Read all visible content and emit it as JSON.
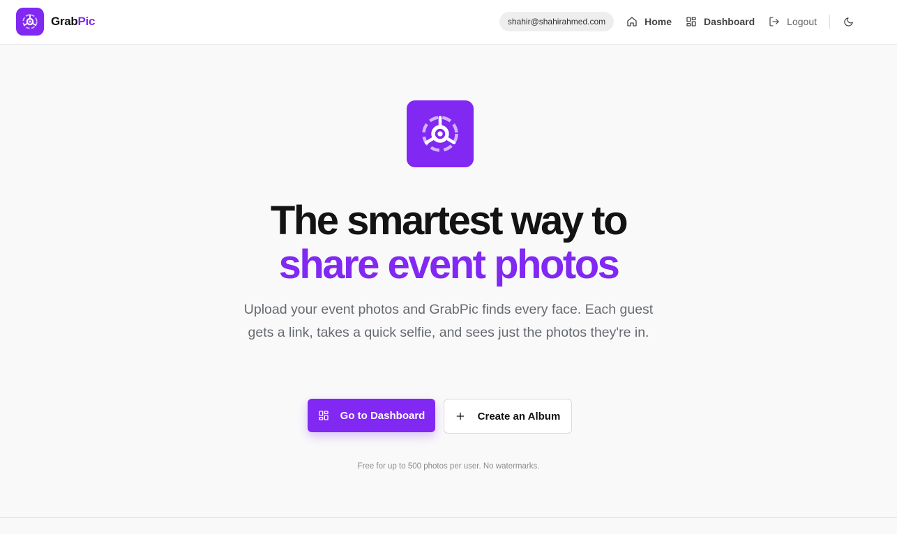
{
  "header": {
    "brand_part1": "Grab",
    "brand_part2": "Pic",
    "user_email": "shahir@shahirahmed.com",
    "nav": {
      "home_label": "Home",
      "dashboard_label": "Dashboard",
      "logout_label": "Logout"
    },
    "theme_icon": "moon-icon"
  },
  "hero": {
    "headline_line1": "The smartest way to",
    "headline_line2": "share event photos",
    "subtitle": "Upload your event photos and GrabPic finds every face. Each guest gets a link, takes a quick selfie, and sees just the photos they're in.",
    "primary_cta": "Go to Dashboard",
    "secondary_cta": "Create an Album",
    "note": "Free for up to 500 photos per user. No watermarks."
  },
  "colors": {
    "accent": "#8128f2",
    "background": "#f9f9f9",
    "text": "#131313",
    "muted": "#666a71"
  }
}
